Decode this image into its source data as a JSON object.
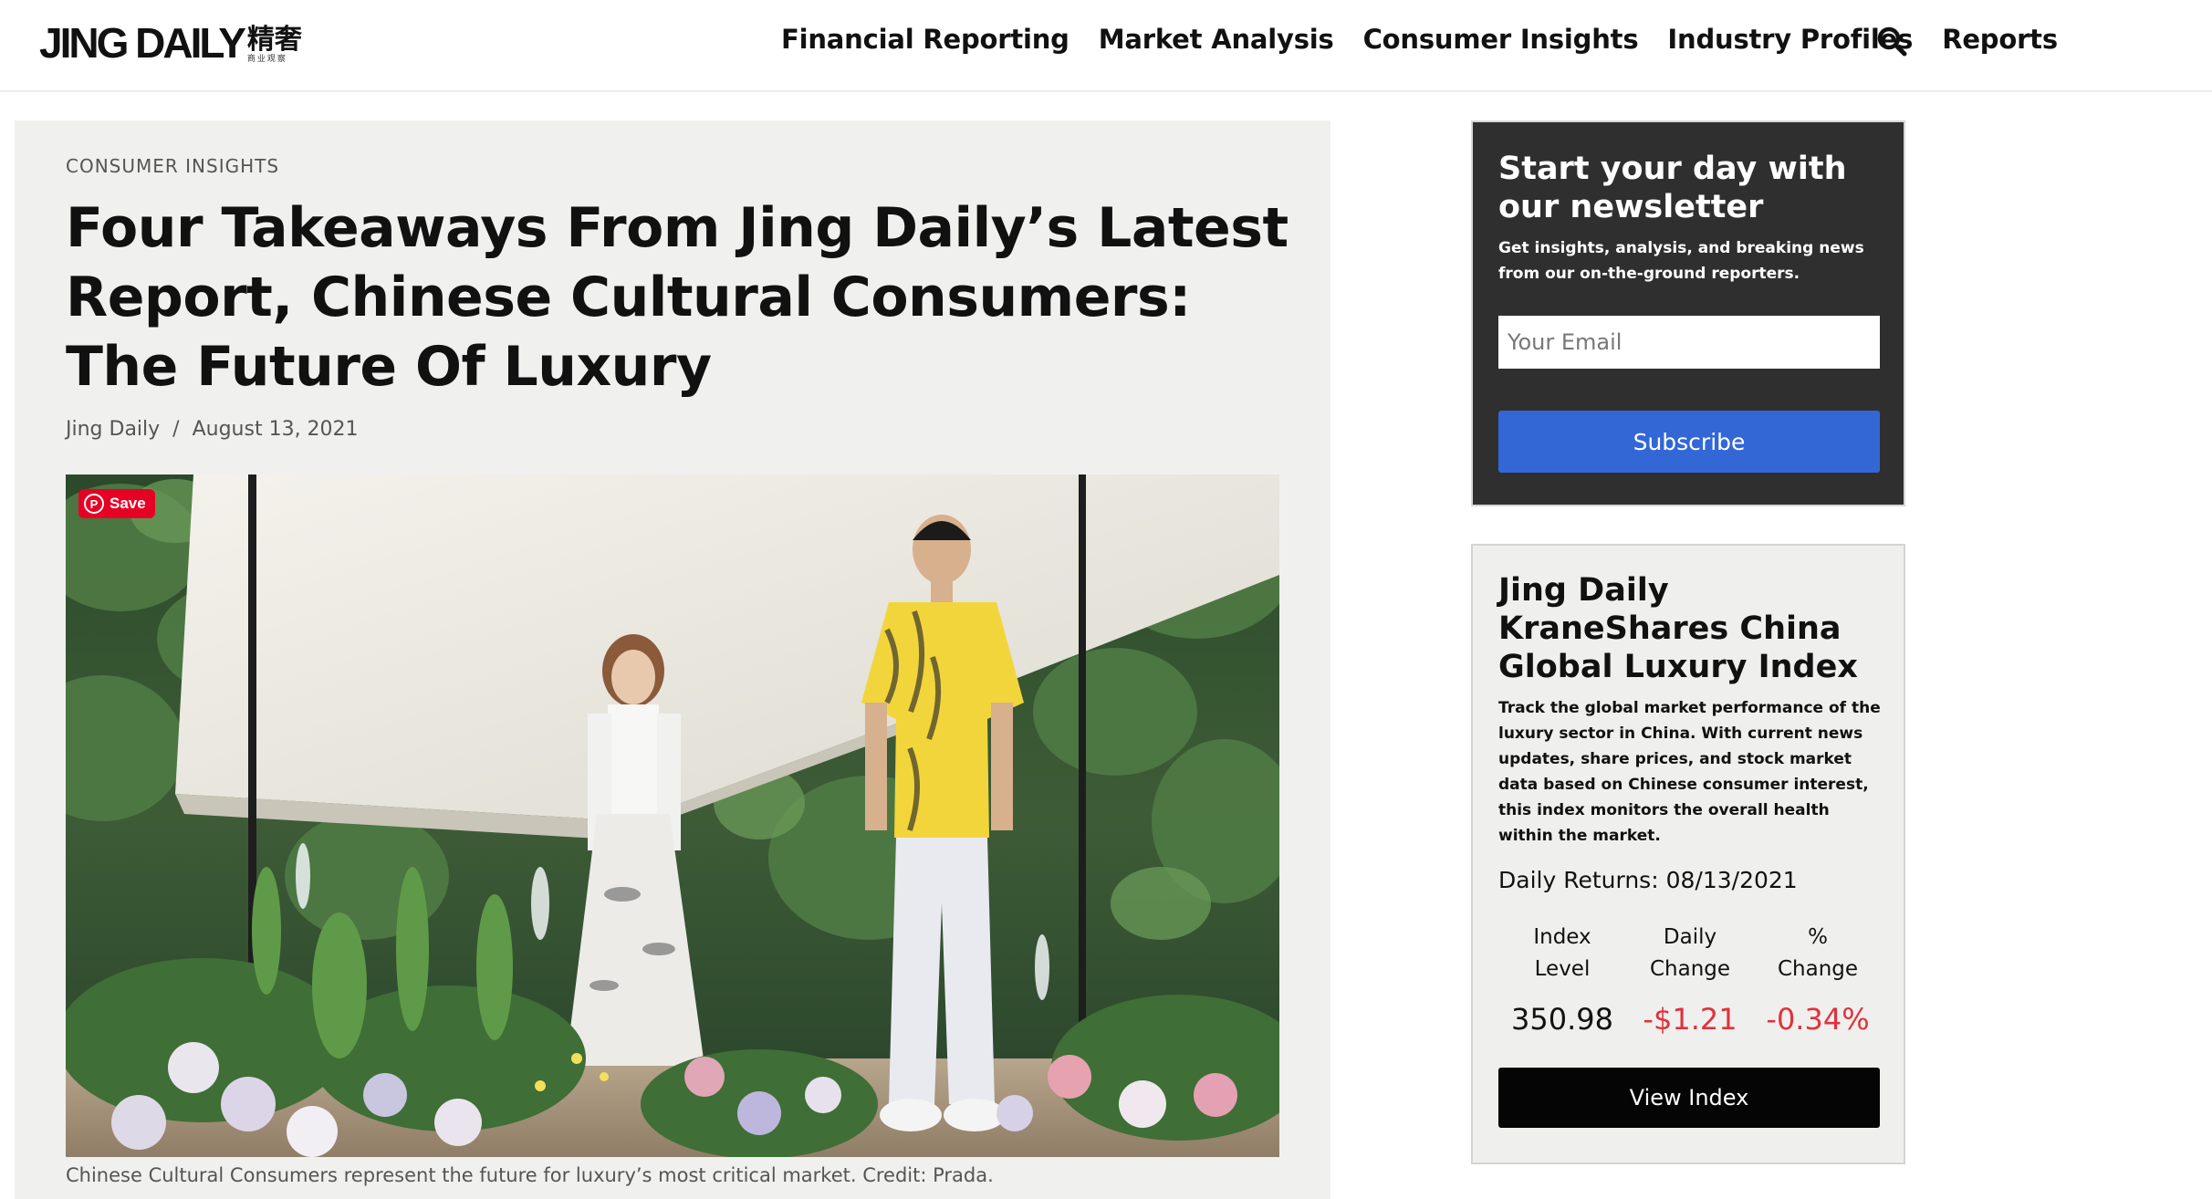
{
  "brand": {
    "name": "JING DAILY",
    "name_cn": "精奢",
    "tagline_cn": "商业观察"
  },
  "nav": {
    "items": [
      "Financial Reporting",
      "Market Analysis",
      "Consumer Insights",
      "Industry Profiles",
      "Reports"
    ],
    "search_icon": "search-icon"
  },
  "article": {
    "category": "CONSUMER INSIGHTS",
    "title": "Four Takeaways From Jing Daily’s Latest Report, Chinese Cultural Consumers: The Future Of Luxury",
    "author": "Jing Daily",
    "separator": "/",
    "date": "August 13, 2021",
    "image": {
      "save_label": "Save",
      "save_icon": "pinterest-icon"
    },
    "caption": "Chinese Cultural Consumers represent the future for luxury’s most critical market. Credit: Prada."
  },
  "newsletter": {
    "title": "Start your day with our newsletter",
    "description": "Get insights, analysis, and breaking news from our on-the-ground reporters.",
    "email_placeholder": "Your Email",
    "email_value": "",
    "subscribe_label": "Subscribe"
  },
  "index": {
    "title": "Jing Daily KraneShares China Global Luxury Index",
    "description": "Track the global market performance of the luxury sector in China. With current news updates, share prices, and stock market data based on Chinese consumer interest, this index monitors the overall health within the market.",
    "returns_label": "Daily Returns:",
    "returns_date": "08/13/2021",
    "columns": [
      {
        "head": [
          "Index",
          "Level"
        ],
        "value": "350.98",
        "negative": false
      },
      {
        "head": [
          "Daily",
          "Change"
        ],
        "value": "-$1.21",
        "negative": true
      },
      {
        "head": [
          "%",
          "Change"
        ],
        "value": "-0.34%",
        "negative": true
      }
    ],
    "button_label": "View Index"
  },
  "colors": {
    "subscribe_button": "#3367d6",
    "negative": "#e0323b",
    "pinterest": "#e60023"
  }
}
